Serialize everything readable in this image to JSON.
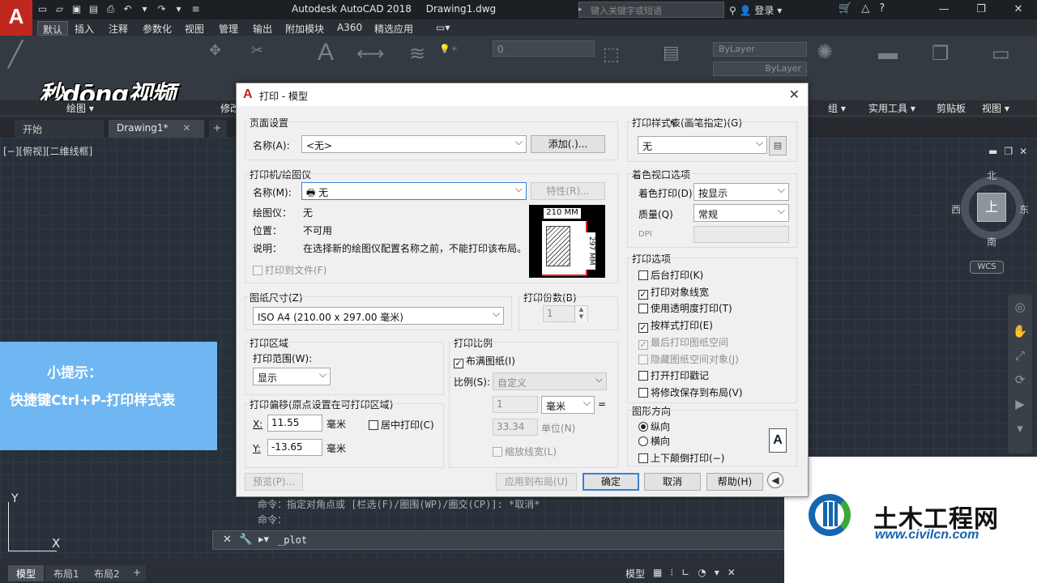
{
  "app": {
    "logo_letter": "A",
    "window_title": "Autodesk AutoCAD 2018",
    "document": "Drawing1.dwg",
    "search_placeholder": "键入关键字或短语",
    "login_label": "登录"
  },
  "ribbon": {
    "tabs": [
      "默认",
      "插入",
      "注释",
      "参数化",
      "视图",
      "管理",
      "输出",
      "附加模块",
      "A360",
      "精选应用"
    ],
    "groups": [
      "绘图 ▾",
      "修改",
      "组 ▾",
      "实用工具 ▾",
      "剪贴板",
      "视图 ▾"
    ],
    "overlay_logo": "秒dōng视频",
    "bylayer_1": "ByLayer",
    "bylayer_2": "ByLayer",
    "layer_value": "0"
  },
  "doc_tabs": [
    "开始",
    "Drawing1*"
  ],
  "viewport": {
    "label": "[−][俯视][二维线框]",
    "cube_top": "上",
    "north": "北",
    "south": "南",
    "east": "东",
    "west": "西",
    "wcs": "WCS"
  },
  "tip": {
    "title": "小提示：",
    "text": "快捷键Ctrl+P-打印样式表"
  },
  "ucs": {
    "x": "X",
    "y": "Y"
  },
  "command": {
    "history_1": "命令：指定对角点或 [栏选(F)/圈围(WP)/圈交(CP)]: *取消*",
    "history_2": "命令：",
    "current": "_plot"
  },
  "layout_tabs": [
    "模型",
    "布局1",
    "布局2"
  ],
  "status": {
    "model": "模型"
  },
  "watermark": {
    "name": "土木工程网",
    "url": "www.civilcn.com"
  },
  "dialog": {
    "title": "打印 - 模型",
    "page_setup": {
      "legend": "页面设置",
      "name_label": "名称(A):",
      "name_value": "<无>",
      "add_button": "添加(.)..."
    },
    "printer": {
      "legend": "打印机/绘图仪",
      "name_label": "名称(M):",
      "name_value": "无",
      "properties_button": "特性(R)...",
      "plotter_label": "绘图仪：",
      "plotter_value": "无",
      "location_label": "位置：",
      "location_value": "不可用",
      "desc_label": "说明：",
      "desc_value": "在选择新的绘图仪配置名称之前，不能打印该布局。",
      "to_file": "打印到文件(F)",
      "paper_width": "210 MM",
      "paper_height": "297 MM"
    },
    "paper_size": {
      "legend": "图纸尺寸(Z)",
      "value": "ISO A4 (210.00 x 297.00 毫米)"
    },
    "copies": {
      "legend": "打印份数(B)",
      "value": "1"
    },
    "plot_area": {
      "legend": "打印区域",
      "range_label": "打印范围(W):",
      "range_value": "显示"
    },
    "plot_offset": {
      "legend": "打印偏移(原点设置在可打印区域)",
      "x_label": "X:",
      "x_value": "11.55",
      "y_label": "Y:",
      "y_value": "-13.65",
      "unit": "毫米",
      "center": "居中打印(C)"
    },
    "plot_scale": {
      "legend": "打印比例",
      "fit": "布满图纸(I)",
      "scale_label": "比例(S):",
      "scale_value": "自定义",
      "num": "1",
      "unit_value": "毫米",
      "equals": "=",
      "denom": "33.34",
      "unit_label": "单位(N)",
      "lineweights": "缩放线宽(L)"
    },
    "style_table": {
      "legend": "打印样式表(画笔指定)(G)",
      "value": "无"
    },
    "shaded": {
      "legend": "着色视口选项",
      "shade_label": "着色打印(D)",
      "shade_value": "按显示",
      "quality_label": "质量(Q)",
      "quality_value": "常规",
      "dpi_label": "DPI"
    },
    "options": {
      "legend": "打印选项",
      "items": [
        {
          "label": "后台打印(K)",
          "checked": "",
          "disabled": false
        },
        {
          "label": "打印对象线宽",
          "checked": "✓",
          "disabled": false
        },
        {
          "label": "使用透明度打印(T)",
          "checked": "",
          "disabled": false
        },
        {
          "label": "按样式打印(E)",
          "checked": "✓",
          "disabled": false
        },
        {
          "label": "最后打印图纸空间",
          "checked": "✓",
          "disabled": true
        },
        {
          "label": "隐藏图纸空间对象(J)",
          "checked": "",
          "disabled": true
        },
        {
          "label": "打开打印戳记",
          "checked": "",
          "disabled": false
        },
        {
          "label": "将修改保存到布局(V)",
          "checked": "",
          "disabled": false
        }
      ]
    },
    "orientation": {
      "legend": "图形方向",
      "portrait": "纵向",
      "landscape": "横向",
      "upside_down": "上下颠倒打印(−)",
      "icon_letter": "A"
    },
    "buttons": {
      "preview": "预览(P)...",
      "apply": "应用到布局(U)",
      "ok": "确定",
      "cancel": "取消",
      "help": "帮助(H)"
    }
  }
}
